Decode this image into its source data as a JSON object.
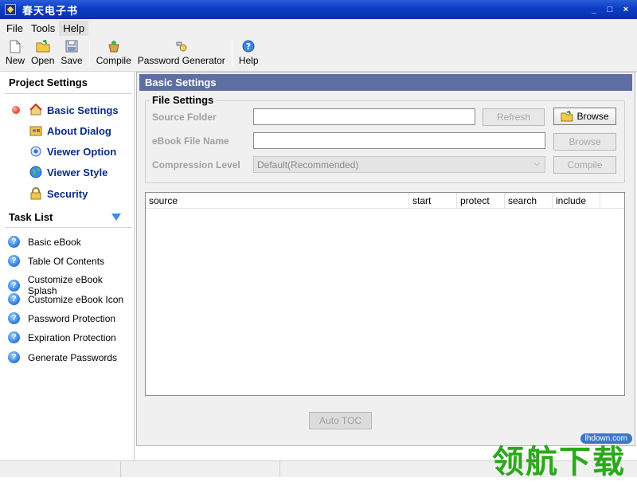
{
  "window": {
    "title": "春天电子书",
    "min": "_",
    "max": "□",
    "close": "×"
  },
  "menubar": [
    "File",
    "Tools",
    "Help"
  ],
  "toolbar": {
    "new": "New",
    "open": "Open",
    "save": "Save",
    "compile": "Compile",
    "password_generator": "Password Generator",
    "help": "Help"
  },
  "sidebar": {
    "project_title": "Project Settings",
    "project_items": [
      {
        "label": "Basic Settings",
        "icon": "home-icon"
      },
      {
        "label": "About Dialog",
        "icon": "about-icon"
      },
      {
        "label": "Viewer Option",
        "icon": "viewer-option-icon"
      },
      {
        "label": "Viewer Style",
        "icon": "globe-icon"
      },
      {
        "label": "Security",
        "icon": "lock-icon"
      }
    ],
    "task_title": "Task List",
    "task_items": [
      "Basic eBook",
      "Table Of Contents",
      "Customize eBook Splash",
      "Customize eBook Icon",
      "Password Protection",
      "Expiration Protection",
      "Generate Passwords"
    ]
  },
  "main": {
    "header": "Basic Settings",
    "group_title": "File Settings",
    "source_folder_label": "Source Folder",
    "ebook_file_name_label": "eBook File Name",
    "compression_level_label": "Compression Level",
    "compression_value": "Default(Recommended)",
    "source_folder_value": "",
    "ebook_file_name_value": "",
    "refresh": "Refresh",
    "browse": "Browse",
    "browse2": "Browse",
    "compile": "Compile",
    "columns": [
      "source",
      "start",
      "protect",
      "search",
      "include"
    ],
    "auto_toc": "Auto TOC"
  },
  "watermark": {
    "brand": "领航下载",
    "url": "lhdown.com"
  },
  "colors": {
    "titlebar": "#0a3cc4",
    "panel_header": "#5f6ea2",
    "nav_link": "#0b2a8c",
    "watermark_green": "#2ca81c"
  }
}
